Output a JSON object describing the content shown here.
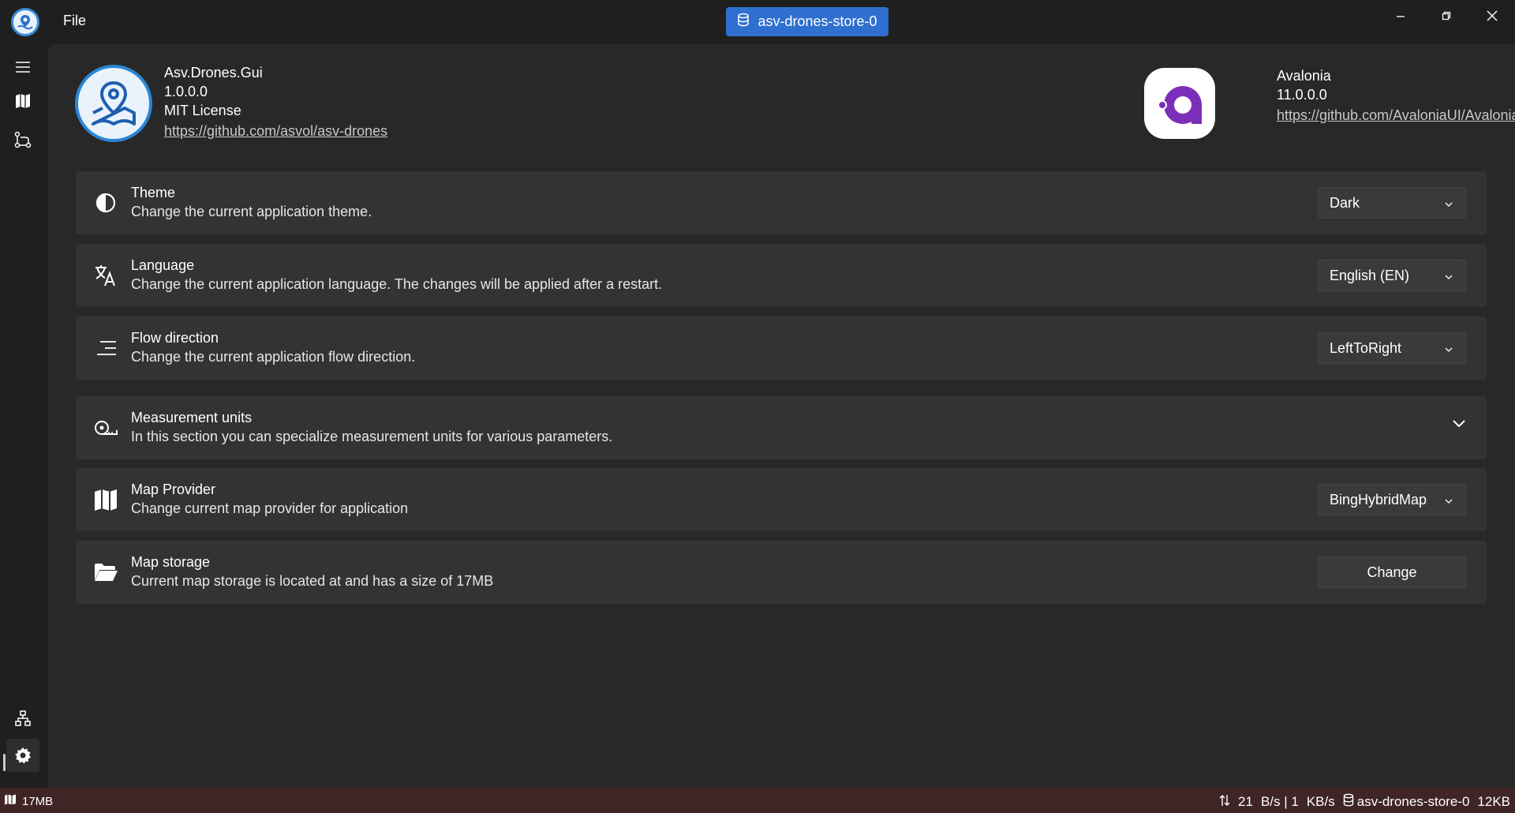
{
  "titlebar": {
    "menu_file": "File",
    "store_name": "asv-drones-store-0",
    "accent": "#2f6fd0"
  },
  "app_about": {
    "name": "Asv.Drones.Gui",
    "version": "1.0.0.0",
    "license": "MIT License",
    "url": "https://github.com/asvol/asv-drones"
  },
  "framework_about": {
    "name": "Avalonia",
    "version": "11.0.0.0",
    "url": "https://github.com/AvaloniaUI/Avalonia",
    "brand_color": "#8b3fc8"
  },
  "settings": {
    "theme": {
      "title": "Theme",
      "description": "Change the current application theme.",
      "value": "Dark"
    },
    "language": {
      "title": "Language",
      "description": "Change the current application language. The changes will be applied after a restart.",
      "value": "English (EN)"
    },
    "flow_direction": {
      "title": "Flow direction",
      "description": "Change the current application flow direction.",
      "value": "LeftToRight"
    },
    "measurement_units": {
      "title": "Measurement units",
      "description": "In this section you can specialize measurement units for various parameters."
    },
    "map_provider": {
      "title": "Map Provider",
      "description": "Change current map provider for application",
      "value": "BingHybridMap"
    },
    "map_storage": {
      "title": "Map storage",
      "description": "Current map storage is located at  and has a size of 17MB",
      "button_label": "Change"
    }
  },
  "statusbar": {
    "map_size": "17MB",
    "traffic_in": "21",
    "traffic_unit_in": "B/s | 1",
    "traffic_unit_out": "KB/s",
    "store_name": "asv-drones-store-0",
    "store_size": "12KB",
    "bg_color": "#3f2525"
  }
}
